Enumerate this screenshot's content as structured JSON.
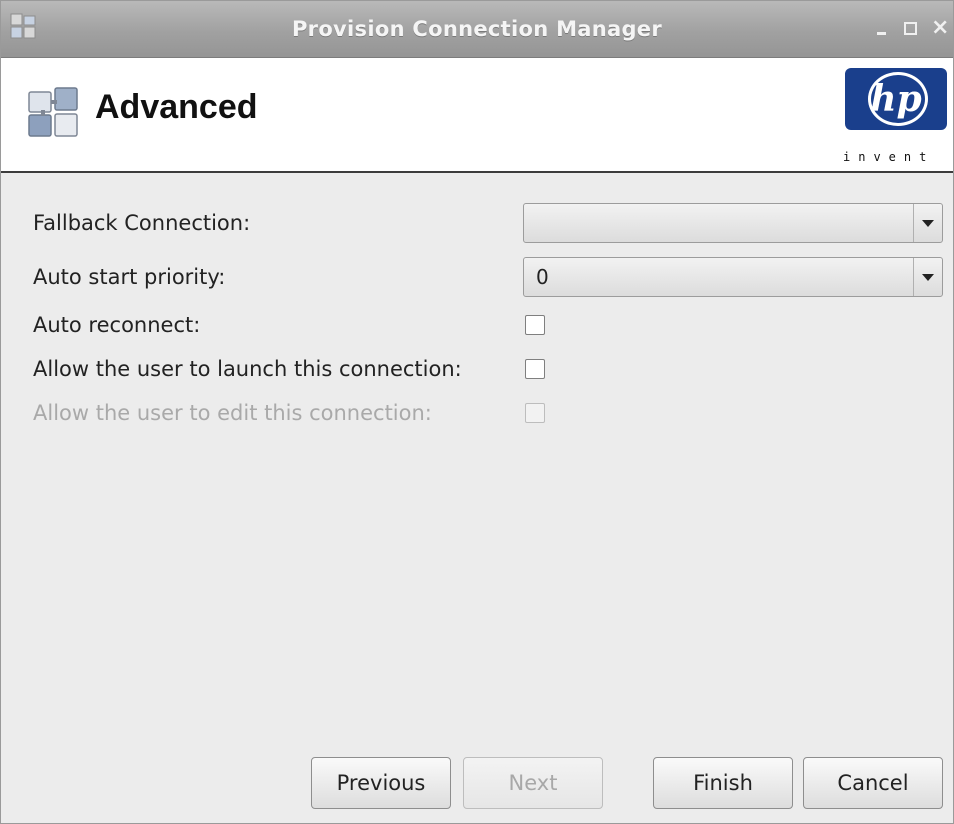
{
  "window": {
    "title": "Provision Connection Manager",
    "controls": [
      "minimize-icon",
      "maximize-icon",
      "close-icon"
    ],
    "close_glyph": "×"
  },
  "header": {
    "title": "Advanced",
    "logo": {
      "letters": "hp",
      "tagline": "invent",
      "color": "#1a3f8c"
    }
  },
  "fields": [
    {
      "label": "Fallback Connection:",
      "type": "select",
      "value": ""
    },
    {
      "label": "Auto start priority:",
      "type": "select",
      "value": "0"
    },
    {
      "label": "Auto reconnect:",
      "type": "checkbox",
      "checked": false
    },
    {
      "label": "Allow the user to launch this connection:",
      "type": "checkbox",
      "checked": false
    },
    {
      "label": "Allow the user to edit this connection:",
      "type": "checkbox",
      "checked": false,
      "disabled": true
    }
  ],
  "buttons": {
    "previous": "Previous",
    "next": "Next",
    "finish": "Finish",
    "cancel": "Cancel"
  }
}
